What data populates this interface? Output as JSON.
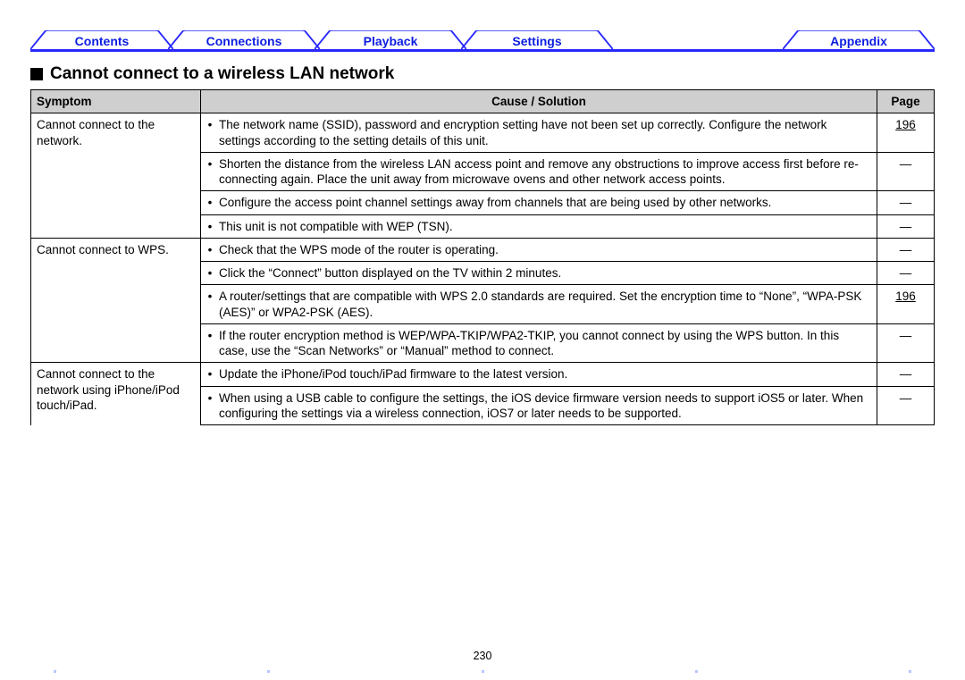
{
  "tabs": {
    "contents": "Contents",
    "connections": "Connections",
    "playback": "Playback",
    "settings": "Settings",
    "appendix": "Appendix"
  },
  "heading": "Cannot connect to a wireless LAN network",
  "table": {
    "headers": {
      "symptom": "Symptom",
      "cause": "Cause / Solution",
      "page": "Page"
    },
    "symptoms": {
      "s1": "Cannot connect to the network.",
      "s2": "Cannot connect to WPS.",
      "s3": "Cannot connect to the network using iPhone/iPod touch/iPad."
    },
    "rows": {
      "r1": {
        "cause": "The network name (SSID), password and encryption setting have not been set up correctly. Configure the network settings according to the setting details of this unit.",
        "page": "196",
        "link": true
      },
      "r2": {
        "cause": "Shorten the distance from the wireless LAN access point and remove any obstructions to improve access first before re-connecting again. Place the unit away from microwave ovens and other network access points.",
        "page": "—"
      },
      "r3": {
        "cause": "Configure the access point channel settings away from channels that are being used by other networks.",
        "page": "—"
      },
      "r4": {
        "cause": "This unit is not compatible with WEP (TSN).",
        "page": "—"
      },
      "r5": {
        "cause": "Check that the WPS mode of the router is operating.",
        "page": "—"
      },
      "r6": {
        "cause": "Click the “Connect” button displayed on the TV within 2 minutes.",
        "page": "—"
      },
      "r7": {
        "cause": "A router/settings that are compatible with WPS 2.0 standards are required. Set the encryption time to “None”, “WPA-PSK (AES)” or WPA2-PSK (AES).",
        "page": "196",
        "link": true
      },
      "r8": {
        "cause": "If the router encryption method is WEP/WPA-TKIP/WPA2-TKIP, you cannot connect by using the WPS button. In this case, use the “Scan Networks” or “Manual” method to connect.",
        "page": "—"
      },
      "r9": {
        "cause": "Update the iPhone/iPod touch/iPad firmware to the latest version.",
        "page": "—"
      },
      "r10": {
        "cause": "When using a USB cable to configure the settings, the iOS device firmware version needs to support iOS5 or later. When configuring the settings via a wireless connection, iOS7 or later needs to be supported.",
        "page": "—"
      }
    }
  },
  "page_number": "230"
}
